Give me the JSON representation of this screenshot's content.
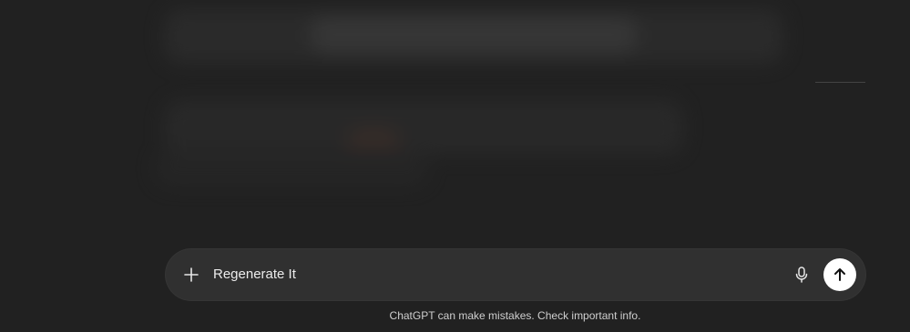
{
  "composer": {
    "input_value": "Regenerate It",
    "plus_icon": "plus-icon",
    "mic_icon": "microphone-icon",
    "send_icon": "arrow-up-icon"
  },
  "footer": {
    "disclaimer": "ChatGPT can make mistakes. Check important info."
  },
  "colors": {
    "background": "#212121",
    "composer_bg": "#303030",
    "send_button": "#ffffff"
  }
}
